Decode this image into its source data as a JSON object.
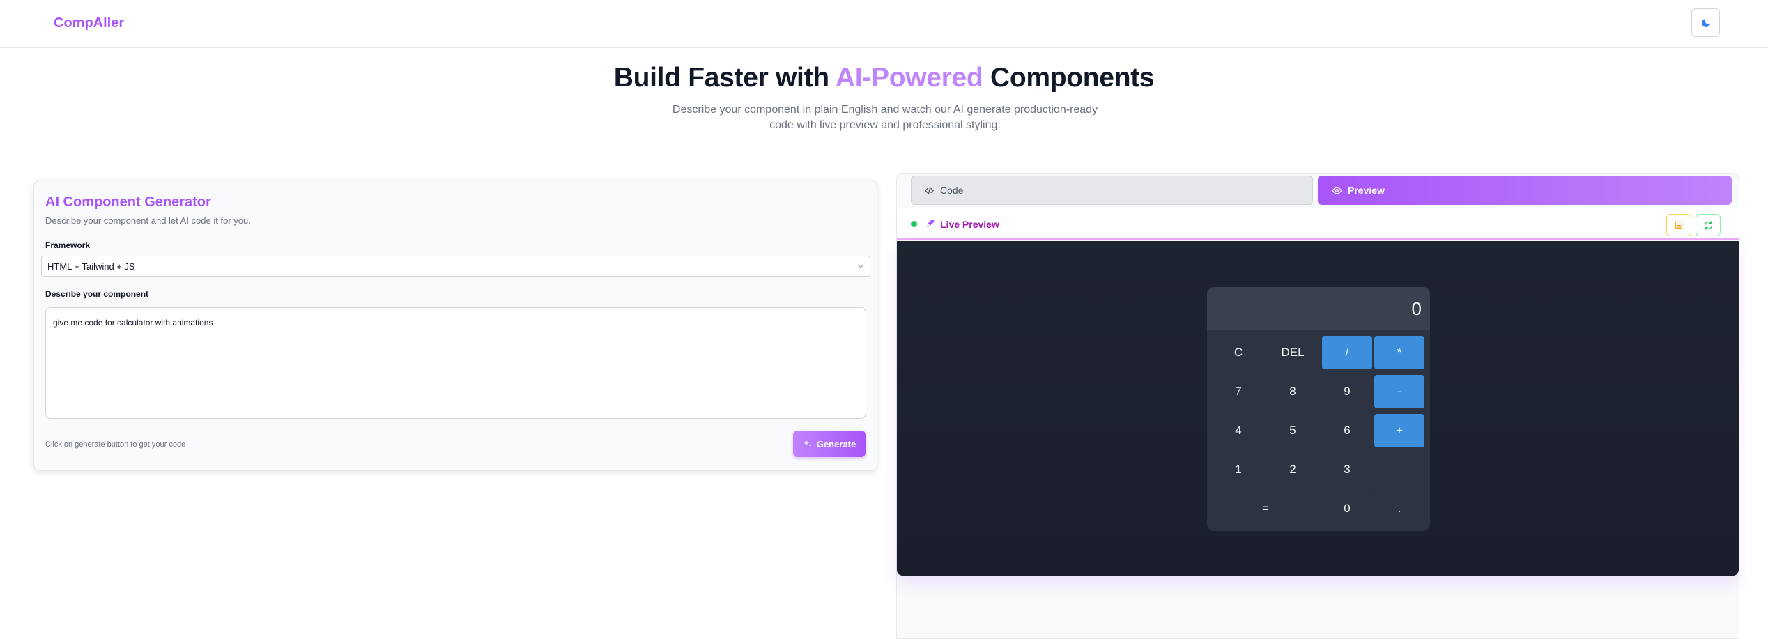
{
  "header": {
    "logo": "CompAller",
    "theme_icon": "moon-icon"
  },
  "hero": {
    "title_start": "Build Faster with ",
    "title_accent": "AI-Powered",
    "title_end": " Components",
    "subtitle": "Describe your component in plain English and watch our AI generate production-ready code with live preview and professional styling."
  },
  "generator": {
    "title": "AI Component Generator",
    "description": "Describe your component and let AI code it for you.",
    "framework_label": "Framework",
    "framework_value": "HTML + Tailwind + JS",
    "prompt_label": "Describe your component",
    "prompt_value": "give me code for calculator with animations",
    "hint": "Click on generate button to get your code",
    "generate_label": "Generate"
  },
  "preview": {
    "tabs": [
      {
        "label": "Code",
        "icon": "code-icon"
      },
      {
        "label": "Preview",
        "icon": "eye-icon"
      }
    ],
    "live_label": "Live Preview",
    "colors": {
      "accent": "#a855f7",
      "live": "#22c55e",
      "calc_op": "#3b8fdc",
      "stage": "#1e2330"
    }
  },
  "calculator": {
    "display": "0",
    "keys": [
      {
        "label": "C",
        "op": false
      },
      {
        "label": "DEL",
        "op": false
      },
      {
        "label": "/",
        "op": true
      },
      {
        "label": "*",
        "op": true
      },
      {
        "label": "7",
        "op": false
      },
      {
        "label": "8",
        "op": false
      },
      {
        "label": "9",
        "op": false
      },
      {
        "label": "-",
        "op": true
      },
      {
        "label": "4",
        "op": false
      },
      {
        "label": "5",
        "op": false
      },
      {
        "label": "6",
        "op": false
      },
      {
        "label": "+",
        "op": true
      },
      {
        "label": "1",
        "op": false
      },
      {
        "label": "2",
        "op": false
      },
      {
        "label": "3",
        "op": false
      },
      {
        "label": "=",
        "op": false
      },
      {
        "label": "0",
        "op": false
      },
      {
        "label": ".",
        "op": false
      }
    ]
  }
}
